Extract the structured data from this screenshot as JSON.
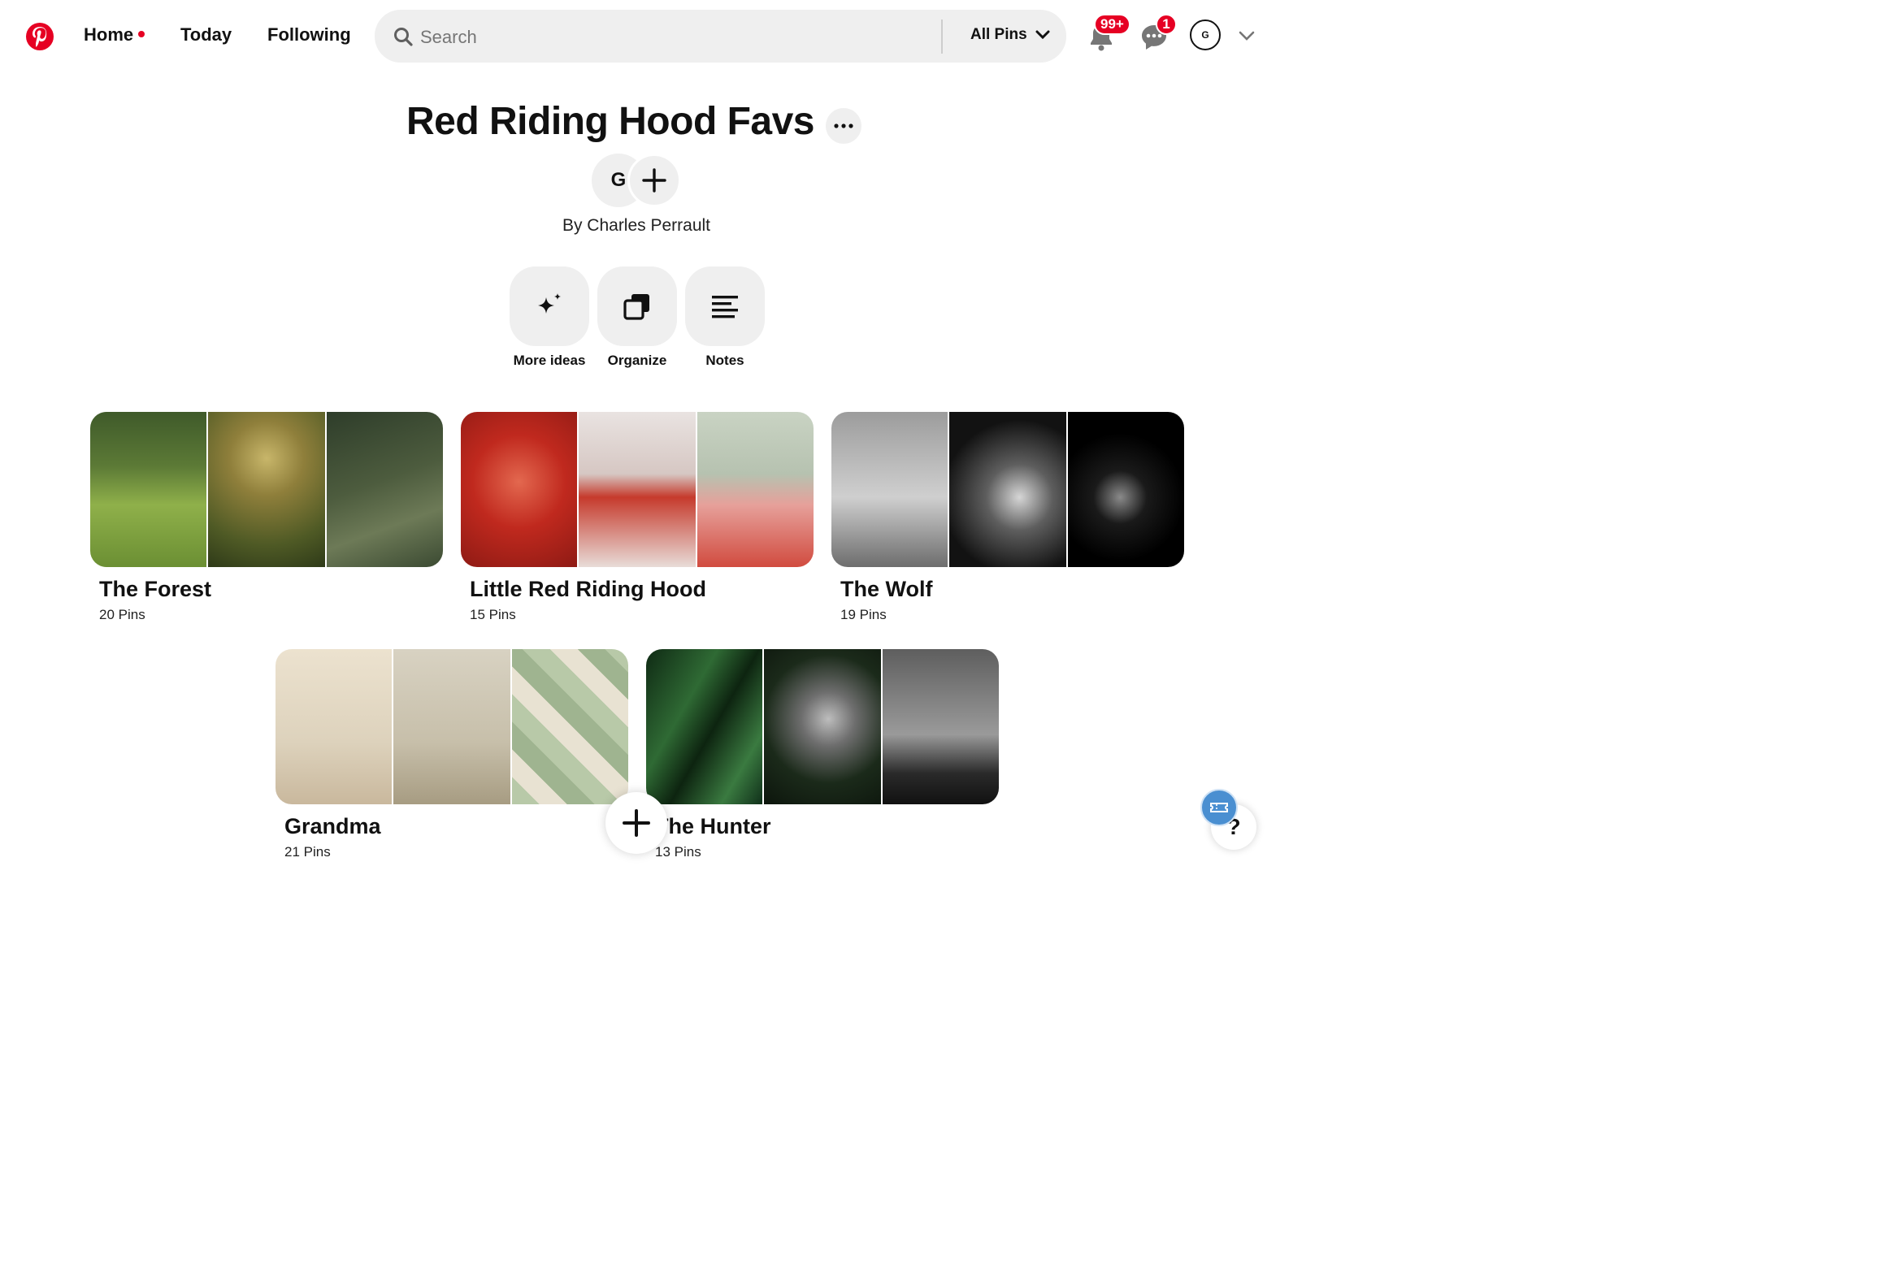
{
  "header": {
    "nav": [
      {
        "label": "Home",
        "has_dot": true
      },
      {
        "label": "Today"
      },
      {
        "label": "Following"
      }
    ],
    "search": {
      "placeholder": "Search",
      "filter_label": "All Pins"
    },
    "notifications_badge": "99+",
    "messages_badge": "1",
    "avatar_initial": "G"
  },
  "board": {
    "title": "Red Riding Hood Favs",
    "collaborator_initial": "G",
    "byline": "By Charles Perrault",
    "actions": [
      {
        "label": "More ideas",
        "icon": "sparkle-icon"
      },
      {
        "label": "Organize",
        "icon": "organize-icon"
      },
      {
        "label": "Notes",
        "icon": "notes-icon"
      }
    ]
  },
  "sections": [
    {
      "title": "The Forest",
      "count": "20 Pins"
    },
    {
      "title": "Little Red Riding Hood",
      "count": "15 Pins"
    },
    {
      "title": "The Wolf",
      "count": "19 Pins"
    },
    {
      "title": "Grandma",
      "count": "21 Pins"
    },
    {
      "title": "The Hunter",
      "count": "13 Pins"
    }
  ],
  "floating": {
    "help_label": "?"
  },
  "colors": {
    "brand": "#e60023",
    "surface": "#efefef",
    "text": "#111111"
  }
}
